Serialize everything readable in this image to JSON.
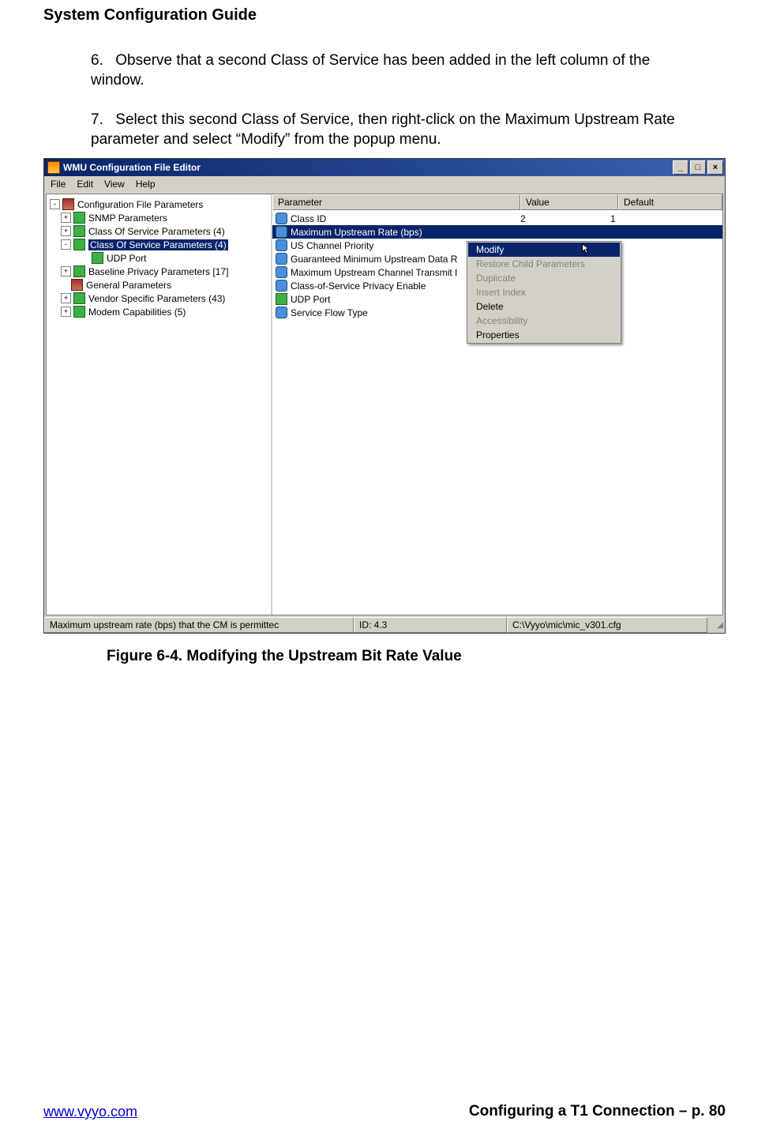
{
  "header": "System Configuration Guide",
  "steps": {
    "six": {
      "num": "6.",
      "text": "Observe that a second Class of Service has been added in the left column of the window."
    },
    "seven": {
      "num": "7.",
      "text": "Select this second Class of Service, then right-click on the Maximum Upstream Rate parameter and select “Modify” from the popup menu."
    }
  },
  "caption": "Figure 6-4. Modifying the Upstream Bit Rate Value",
  "footer": {
    "url": "www.vyyo.com",
    "right": "Configuring a T1 Connection – p. 80"
  },
  "window": {
    "title": "WMU Configuration File Editor",
    "buttons": {
      "min": "_",
      "max": "□",
      "close": "×"
    },
    "menu": [
      "File",
      "Edit",
      "View",
      "Help"
    ],
    "tree": {
      "root": "Configuration File Parameters",
      "items": [
        {
          "exp": "+",
          "label": "SNMP Parameters",
          "icon": "green"
        },
        {
          "exp": "+",
          "label": "Class Of Service Parameters (4)",
          "icon": "green"
        },
        {
          "exp": "-",
          "label": "Class Of Service Parameters (4)",
          "icon": "green",
          "selected": true
        },
        {
          "child": true,
          "label": "UDP Port",
          "icon": "green"
        },
        {
          "exp": "+",
          "label": "Baseline Privacy Parameters [17]",
          "icon": "green"
        },
        {
          "label": "General Parameters",
          "icon": "folder"
        },
        {
          "exp": "+",
          "label": "Vendor Specific Parameters (43)",
          "icon": "green"
        },
        {
          "exp": "+",
          "label": "Modem Capabilities (5)",
          "icon": "green"
        }
      ]
    },
    "list": {
      "headers": {
        "p": "Parameter",
        "v": "Value",
        "d": "Default"
      },
      "rows": [
        {
          "icon": "blue",
          "p": "Class ID",
          "v": "2",
          "d": "1"
        },
        {
          "icon": "blue",
          "p": "Maximum Upstream Rate (bps)",
          "selected": true
        },
        {
          "icon": "blue",
          "p": "US Channel Priority"
        },
        {
          "icon": "blue",
          "p": "Guaranteed Minimum Upstream Data R"
        },
        {
          "icon": "blue",
          "p": "Maximum Upstream Channel Transmit I"
        },
        {
          "icon": "blue",
          "p": "Class-of-Service Privacy Enable"
        },
        {
          "icon": "green",
          "p": "UDP Port"
        },
        {
          "icon": "blue",
          "p": "Service Flow Type"
        }
      ]
    },
    "context": {
      "items": [
        {
          "label": "Modify",
          "selected": true,
          "cursor": true
        },
        {
          "label": "Restore Child Parameters",
          "disabled": true
        },
        {
          "label": "Duplicate",
          "disabled": true
        },
        {
          "label": "Insert Index",
          "disabled": true
        },
        {
          "label": "Delete"
        },
        {
          "label": "Accessibility",
          "disabled": true
        },
        {
          "label": "Properties"
        }
      ]
    },
    "status": {
      "s1": "Maximum upstream rate (bps) that the CM is permittec",
      "s2": "ID: 4.3",
      "s3": "C:\\Vyyo\\mic\\mic_v301.cfg"
    }
  }
}
